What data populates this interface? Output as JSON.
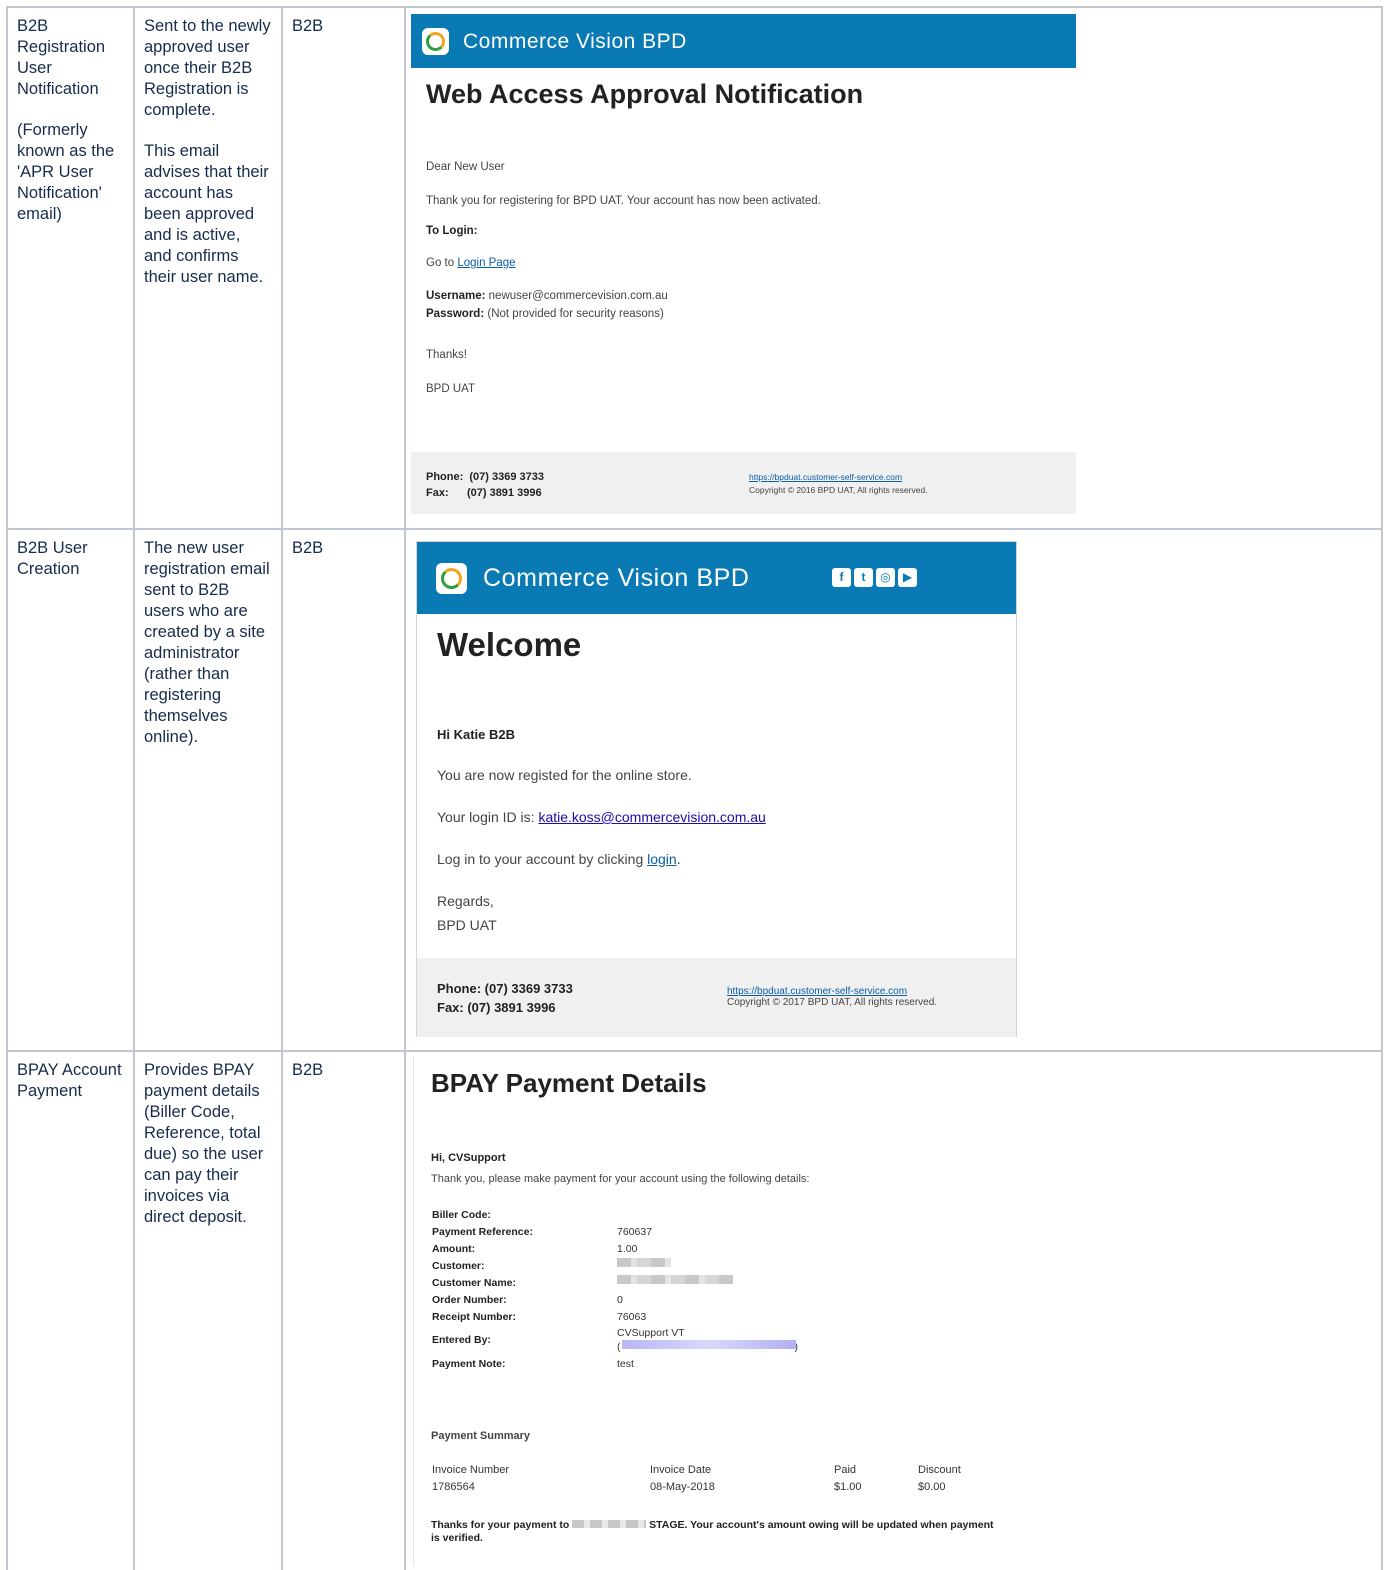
{
  "rows": [
    {
      "name_lines": [
        "B2B Registration User Notification",
        "(Formerly known as the 'APR User Notification' email)"
      ],
      "description_lines": [
        "Sent to the newly approved user once their B2B Registration is complete.",
        "This email advises that their account has been approved and is active, and confirms their user name."
      ],
      "type": "B2B"
    },
    {
      "name_lines": [
        "B2B User Creation"
      ],
      "description_lines": [
        "The new user registration email sent to B2B users who are created by a site administrator (rather than registering themselves online)."
      ],
      "type": "B2B"
    },
    {
      "name_lines": [
        "BPAY Account Payment"
      ],
      "description_lines": [
        "Provides BPAY payment details (Biller Code, Reference, total due) so the user can pay their invoices via direct deposit."
      ],
      "type": "B2B"
    }
  ],
  "email1": {
    "brand": "Commerce Vision BPD",
    "title": "Web Access Approval Notification",
    "greeting": "Dear New User",
    "thanks_line": "Thank you for registering for BPD UAT. Your account has now been activated.",
    "to_login": "To Login:",
    "go_to": "Go to",
    "login_link": "Login Page",
    "username_label": "Username:",
    "username_value": "newuser@commercevision.com.au",
    "password_label": "Password:",
    "password_value": "(Not provided for security reasons)",
    "signoff": "Thanks!",
    "signature": "BPD UAT",
    "phone": "Phone:  (07) 3369 3733",
    "fax": "Fax:      (07) 3891 3996",
    "site_link": "https://bpduat.customer-self-service.com",
    "copyright": "Copyright © 2016 BPD UAT, All rights reserved."
  },
  "email2": {
    "brand": "Commerce Vision BPD",
    "social_icons": [
      "facebook-icon",
      "twitter-icon",
      "instagram-icon",
      "youtube-icon"
    ],
    "title": "Welcome",
    "greeting": "Hi Katie B2B",
    "registered_line": "You are now registed for the online store.",
    "login_id_label": "Your login ID is:",
    "login_id": "katie.koss@commercevision.com.au",
    "login_prompt": "Log in to your account by clicking",
    "login_link": "login",
    "regards": "Regards,",
    "signature": "BPD UAT",
    "phone": "Phone: (07) 3369 3733",
    "fax": "Fax: (07) 3891 3996",
    "site_link": "https://bpduat.customer-self-service.com",
    "copyright": "Copyright © 2017 BPD UAT, All rights reserved."
  },
  "email3": {
    "title": "BPAY Payment Details",
    "greeting": "Hi, CVSupport",
    "intro": "Thank you, please make payment for your account using the following details:",
    "fields": [
      {
        "label": "Biller Code:",
        "value": ""
      },
      {
        "label": "Payment Reference:",
        "value": "760637"
      },
      {
        "label": "Amount:",
        "value": "1.00"
      },
      {
        "label": "Customer:",
        "value": ""
      },
      {
        "label": "Customer Name:",
        "value": ""
      },
      {
        "label": "Order Number:",
        "value": "0"
      },
      {
        "label": "Receipt Number:",
        "value": "76063"
      },
      {
        "label": "Entered By:",
        "value": "CVSupport VT"
      },
      {
        "label": "Payment Note:",
        "value": "test"
      }
    ],
    "summary_title": "Payment Summary",
    "table_headers": [
      "Invoice Number",
      "Invoice Date",
      "Paid",
      "Discount"
    ],
    "table_row": [
      "1786564",
      "08-May-2018",
      "$1.00",
      "$0.00"
    ],
    "footer_prefix": "Thanks for your payment to",
    "footer_suffix": "STAGE. Your account's amount owing will be updated when payment",
    "footer_line2": "is verified."
  }
}
